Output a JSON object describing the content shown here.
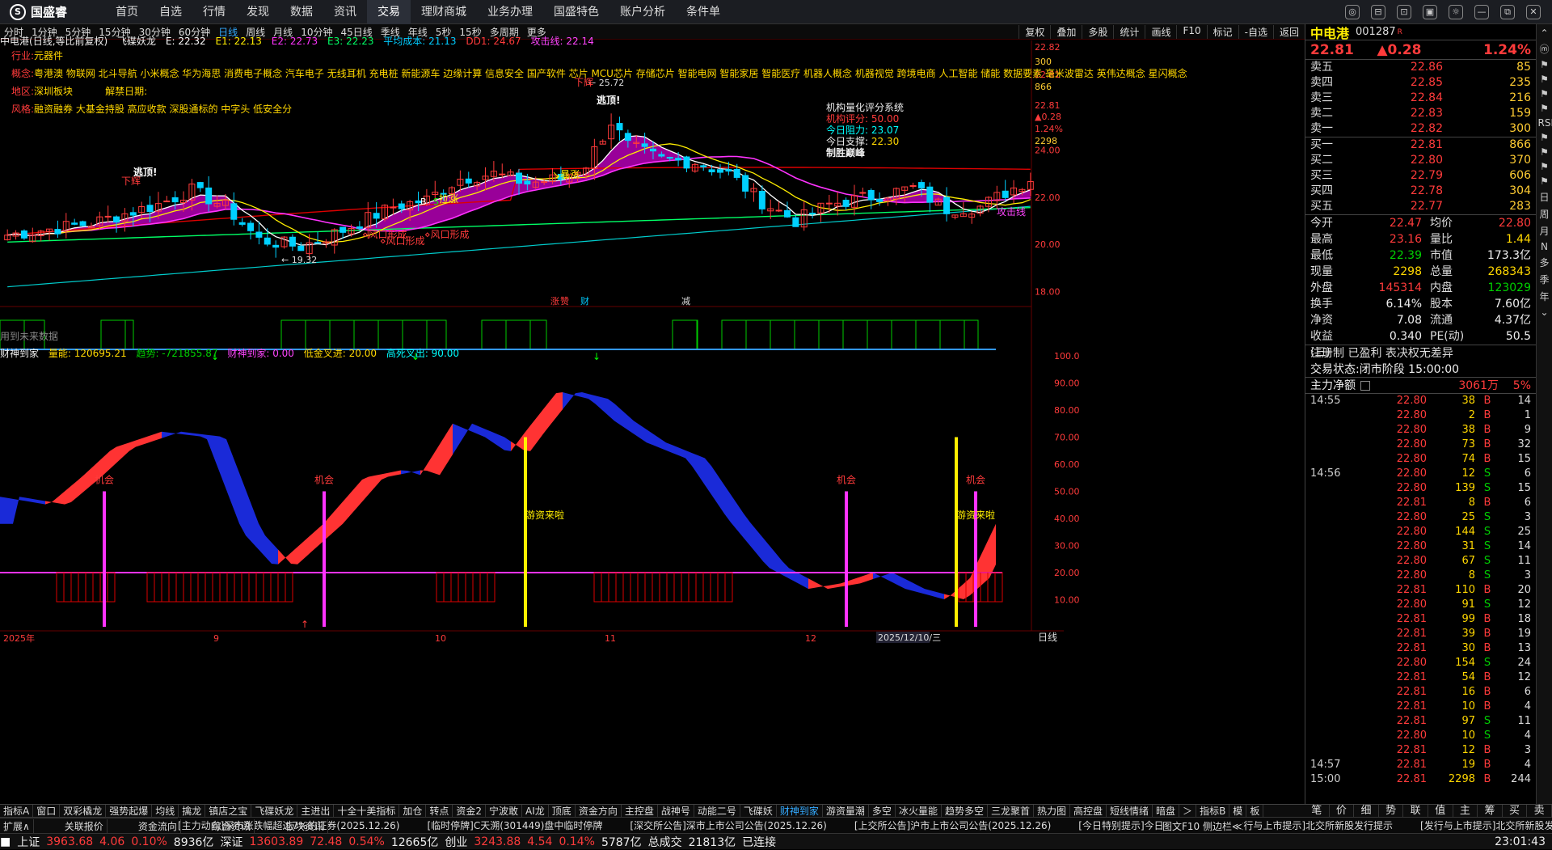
{
  "app": {
    "logo": "国盛睿",
    "mark": "S"
  },
  "nav": [
    "首页",
    "自选",
    "行情",
    "发现",
    "数据",
    "资讯",
    "交易",
    "理财商城",
    "业务办理",
    "国盛特色",
    "账户分析",
    "条件单"
  ],
  "nav_active": 6,
  "winbtns": [
    "◎",
    "⊟",
    "⊡",
    "▣",
    "☼",
    "—",
    "⧉",
    "✕"
  ],
  "periods": [
    "分时",
    "1分钟",
    "5分钟",
    "15分钟",
    "30分钟",
    "60分钟",
    "日线",
    "周线",
    "月线",
    "10分钟",
    "45日线",
    "季线",
    "年线",
    "5秒",
    "15秒",
    "多周期",
    "更多"
  ],
  "period_active": 6,
  "rtools": [
    "复权",
    "叠加",
    "多股",
    "统计",
    "画线",
    "F10",
    "标记",
    "-自选",
    "返回"
  ],
  "legend": {
    "name": "中电港",
    "mode": "(日线,等比前复权)",
    "ind": "飞碟妖龙",
    "E": "E: 22.32",
    "E1": "E1: 22.13",
    "E2": "E2: 22.73",
    "E3": "E3: 22.23",
    "avg": "平均成本: 21.13",
    "dd1": "DD1: 24.67",
    "atk": "攻击线: 22.14"
  },
  "info": {
    "industry_label": "行业:",
    "industry": "元器件",
    "concept_label": "概念:",
    "concept": "粤港澳 物联网 北斗导航 小米概念 华为海思 消费电子概念 汽车电子 无线耳机 充电桩 新能源车 边缘计算 信息安全 国产软件 芯片 MCU芯片 存储芯片 智能电网 智能家居 智能医疗 机器人概念 机器视觉 跨境电商 人工智能 储能 数据要素 毫米波雷达 英伟达概念 星闪概念",
    "region_label": "地区:",
    "region": "深圳板块",
    "unlock_label": "解禁日期:",
    "style_label": "风格:",
    "style": "融资融券 大基金持股 高应收款 深股通标的 中字头 低安全分"
  },
  "score": {
    "title": "机构量化评分系统",
    "l1": "机构评分:",
    "v1": "50.00",
    "l2": "今日阻力:",
    "v2": "23.07",
    "l3": "今日支撑:",
    "v3": "22.30",
    "l4": "制胜巅峰"
  },
  "labels": {
    "lowpt": "← 19.32",
    "hipt": "← 25.72",
    "sell": "下辉",
    "top": "逃顶!",
    "nouse": "用到未来数据",
    "sigzhang": "涨",
    "sigzhuan": "赞",
    "sigcai": "财",
    "sigjian": "减",
    "win1": "⋄风口形成",
    "win2": "⋄风口形成",
    "win3": "⋄风口形成",
    "boom": "↘暴涨",
    "pull": "拉涨",
    "atkline": "攻击线",
    "sB": "B",
    "sS": "S"
  },
  "sub": {
    "name": "财神到家",
    "l1": "量能: 120695.21",
    "l2": "趋势: -721855.87",
    "l3": "财神到家: 0.00",
    "l4": "低金叉进: 20.00",
    "l5": "高死叉出: 90.00",
    "op": "机会",
    "hot": "游资来啦"
  },
  "yaxis_main": [
    "24.00",
    "22.00",
    "20.00",
    "18.00"
  ],
  "yaxis_top": [
    "22.82",
    "300",
    "22.81",
    "866"
  ],
  "yaxis_misc": [
    "22.81",
    "▲0.28",
    "1.24%",
    "2298"
  ],
  "yaxis_sub": [
    "100.0",
    "90.00",
    "80.00",
    "70.00",
    "60.00",
    "50.00",
    "40.00",
    "30.00",
    "20.00",
    "10.00"
  ],
  "xaxis": [
    "2025年",
    "9",
    "10",
    "11",
    "12"
  ],
  "xcursor": "2025/12/10/三",
  "xperiod": "日线",
  "quote": {
    "name": "中电港",
    "code": "001287",
    "badge": "R",
    "price": "22.81",
    "change": "▲0.28",
    "pct": "1.24%",
    "asks": [
      [
        "卖五",
        "22.86",
        "85"
      ],
      [
        "卖四",
        "22.85",
        "235"
      ],
      [
        "卖三",
        "22.84",
        "216"
      ],
      [
        "卖二",
        "22.83",
        "159"
      ],
      [
        "卖一",
        "22.82",
        "300"
      ]
    ],
    "bids": [
      [
        "买一",
        "22.81",
        "866"
      ],
      [
        "买二",
        "22.80",
        "370"
      ],
      [
        "买三",
        "22.79",
        "606"
      ],
      [
        "买四",
        "22.78",
        "304"
      ],
      [
        "买五",
        "22.77",
        "283"
      ]
    ],
    "stats": [
      [
        "今开",
        "22.47",
        "均价",
        "22.80"
      ],
      [
        "最高",
        "23.16",
        "量比",
        "1.44"
      ],
      [
        "最低",
        "22.39",
        "市值",
        "173.3亿"
      ],
      [
        "现量",
        "2298",
        "总量",
        "268343"
      ],
      [
        "外盘",
        "145314",
        "内盘",
        "123029"
      ],
      [
        "换手",
        "6.14%",
        "股本",
        "7.60亿"
      ],
      [
        "净资",
        "7.08",
        "流通",
        "4.37亿"
      ],
      [
        "收益(三)",
        "0.340",
        "PE(动)",
        "50.5"
      ]
    ],
    "reg": "注册制 已盈利 表决权无差异",
    "status_label": "交易状态:",
    "status": "闭市阶段 15:00:00",
    "main_label": "主力净额",
    "main_val": "3061万",
    "main_pct": "5%"
  },
  "ticks": [
    [
      "14:55",
      "22.80",
      "38",
      "B",
      "14"
    ],
    [
      "",
      "22.80",
      "2",
      "B",
      "1"
    ],
    [
      "",
      "22.80",
      "38",
      "B",
      "9"
    ],
    [
      "",
      "22.80",
      "73",
      "B",
      "32"
    ],
    [
      "",
      "22.80",
      "74",
      "B",
      "15"
    ],
    [
      "14:56",
      "22.80",
      "12",
      "S",
      "6"
    ],
    [
      "",
      "22.80",
      "139",
      "S",
      "15"
    ],
    [
      "",
      "22.81",
      "8",
      "B",
      "6"
    ],
    [
      "",
      "22.80",
      "25",
      "S",
      "3"
    ],
    [
      "",
      "22.80",
      "144",
      "S",
      "25"
    ],
    [
      "",
      "22.80",
      "31",
      "S",
      "14"
    ],
    [
      "",
      "22.80",
      "67",
      "S",
      "11"
    ],
    [
      "",
      "22.80",
      "8",
      "S",
      "3"
    ],
    [
      "",
      "22.81",
      "110",
      "B",
      "20"
    ],
    [
      "",
      "22.80",
      "91",
      "S",
      "12"
    ],
    [
      "",
      "22.81",
      "99",
      "B",
      "18"
    ],
    [
      "",
      "22.81",
      "39",
      "B",
      "19"
    ],
    [
      "",
      "22.81",
      "30",
      "B",
      "13"
    ],
    [
      "",
      "22.80",
      "154",
      "S",
      "24"
    ],
    [
      "",
      "22.81",
      "54",
      "B",
      "12"
    ],
    [
      "",
      "22.81",
      "16",
      "B",
      "6"
    ],
    [
      "",
      "22.81",
      "10",
      "B",
      "4"
    ],
    [
      "",
      "22.81",
      "97",
      "S",
      "11"
    ],
    [
      "",
      "22.80",
      "10",
      "S",
      "4"
    ],
    [
      "",
      "22.81",
      "12",
      "B",
      "3"
    ],
    [
      "14:57",
      "22.81",
      "19",
      "B",
      "4"
    ],
    [
      "15:00",
      "22.81",
      "2298",
      "B",
      "244"
    ]
  ],
  "indtabs": [
    "指标A",
    "窗口",
    "双彩橇龙",
    "强势起爆",
    "均线",
    "擒龙",
    "镇店之宝",
    "飞碟妖龙",
    "主进出",
    "十全十美指标",
    "加仓",
    "转点",
    "资金2",
    "宁波敢",
    "AI龙",
    "顶底",
    "资金方向",
    "主控盘",
    "战神号",
    "动能二号",
    "飞碟妖",
    "财神到家",
    "游资量潮",
    "多空",
    "冰火量能",
    "趋势多空",
    "三龙聚首",
    "热力图",
    "高控盘",
    "短线情绪",
    "暗盘",
    "＞",
    "指标B",
    "模",
    "板"
  ],
  "indtab_active": 21,
  "subtabs": [
    "扩展∧",
    "关联报价",
    "资金流向",
    "综合资讯",
    "板块资讯"
  ],
  "rbtabs": [
    "笔",
    "价",
    "细",
    "势",
    "联",
    "值",
    "主",
    "筹",
    "买",
    "卖"
  ],
  "news": [
    "[主力动向]深市涨跌幅超过7%的证券(2025.12.26)",
    "[临时停牌]C天溯(301449)盘中临时停牌",
    "[深交所公告]深市上市公司公告(2025.12.26)",
    "[上交所公告]沪市上市公司公告(2025.12.26)",
    "[今日特别提示]今日公告提示",
    "[发行与上市提示]北交所新股发行提示",
    "[发行与上市提示]北交所新股发行与上市提示"
  ],
  "newstail": "图文F10  侧边栏≪",
  "status": {
    "sh_label": "上证",
    "sh": "3963.68",
    "sh_chg": "4.06",
    "sh_pct": "0.10%",
    "sh_amt": "8936亿",
    "sz_label": "深证",
    "sz": "13603.89",
    "sz_chg": "72.48",
    "sz_pct": "0.54%",
    "sz_amt": "12665亿",
    "cy_label": "创业",
    "cy": "3243.88",
    "cy_chg": "4.54",
    "cy_pct": "0.14%",
    "cy_amt": "5787亿",
    "tot_label": "总成交",
    "tot": "21813亿",
    "conn": "已连接",
    "time": "23:01:43"
  },
  "sidetools": [
    "⌃",
    "ⓜ",
    "⚑",
    "⚑",
    "⚑",
    "⚑",
    "RSI",
    "⚑",
    "⚑",
    "⚑",
    "⚑",
    "日",
    "周",
    "月",
    "N",
    "多",
    "季",
    "年",
    "⌄"
  ],
  "colors": {
    "up": "#ff3b3b",
    "down": "#00d0ff",
    "ma5": "#ffffff",
    "ma10": "#ffee00",
    "ma20": "#ff33ff",
    "ma60": "#00cccc",
    "ma120": "#00ff66",
    "ma250": "#dd0000",
    "cloud": "#aa00aa"
  },
  "chart_data": {
    "type": "candlestick",
    "title": "中电港 (日线,等比前复权)",
    "ylim": [
      17.5,
      26.6
    ],
    "xlim": [
      "2025-08-01",
      "2025-12-26"
    ],
    "high_mark": 25.72,
    "low_mark": 19.32,
    "last": 22.81
  },
  "subchart": {
    "type": "ribbon",
    "ylim": [
      0,
      100
    ]
  }
}
